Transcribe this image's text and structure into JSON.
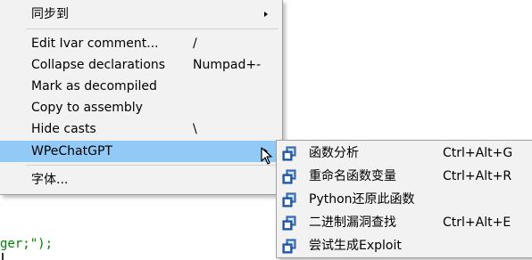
{
  "code": {
    "text": "ger;\");"
  },
  "context_menu": {
    "items": [
      {
        "label": "同步到",
        "shortcut": "",
        "has_submenu": true
      },
      {
        "label": "Edit Ivar comment...",
        "shortcut": "/"
      },
      {
        "label": "Collapse declarations",
        "shortcut": "Numpad+-"
      },
      {
        "label": "Mark as decompiled",
        "shortcut": ""
      },
      {
        "label": "Copy to assembly",
        "shortcut": ""
      },
      {
        "label": "Hide casts",
        "shortcut": "\\"
      },
      {
        "label": "WPeChatGPT",
        "shortcut": "",
        "has_submenu": true,
        "highlighted": true
      },
      {
        "label": "字体...",
        "shortcut": ""
      }
    ]
  },
  "submenu": {
    "items": [
      {
        "label": "函数分析",
        "shortcut": "Ctrl+Alt+G",
        "icon": "plugin-action-icon"
      },
      {
        "label": "重命名函数变量",
        "shortcut": "Ctrl+Alt+R",
        "icon": "plugin-action-icon"
      },
      {
        "label": "Python还原此函数",
        "shortcut": "",
        "icon": "plugin-action-icon"
      },
      {
        "label": "二进制漏洞查找",
        "shortcut": "Ctrl+Alt+E",
        "icon": "plugin-action-icon"
      },
      {
        "label": "尝试生成Exploit",
        "shortcut": "",
        "icon": "plugin-action-icon"
      }
    ]
  },
  "colors": {
    "highlight": "#91c9f7",
    "menu_bg": "#f2f2f2",
    "string": "#008000"
  }
}
